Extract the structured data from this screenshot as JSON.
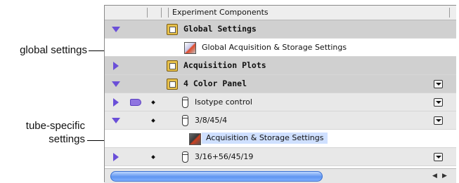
{
  "callouts": {
    "global_settings": "global settings",
    "tube_specific_line1": "tube-specific",
    "tube_specific_line2": "settings"
  },
  "browser": {
    "header_title": "Experiment Components",
    "rows": [
      {
        "label": "Global Settings",
        "icon": "folder-icon",
        "expanded": true
      },
      {
        "label": "Global Acquisition & Storage Settings",
        "icon": "settings-icon"
      },
      {
        "label": "Acquisition Plots",
        "icon": "folder-icon",
        "expanded": false
      },
      {
        "label": "4 Color Panel",
        "icon": "folder-icon",
        "expanded": true
      },
      {
        "label": "Isotype control",
        "icon": "tube-icon",
        "expanded": false
      },
      {
        "label": "3/8/45/4",
        "icon": "tube-icon",
        "expanded": true
      },
      {
        "label": "Acquisition & Storage Settings",
        "icon": "settings-icon",
        "selected": true
      },
      {
        "label": "3/16+56/45/19",
        "icon": "tube-icon",
        "expanded": false
      }
    ]
  },
  "colors": {
    "disclosure": "#6a4fd8",
    "selection": "#cfe0ff",
    "scroll_thumb": "#5f95f0"
  }
}
